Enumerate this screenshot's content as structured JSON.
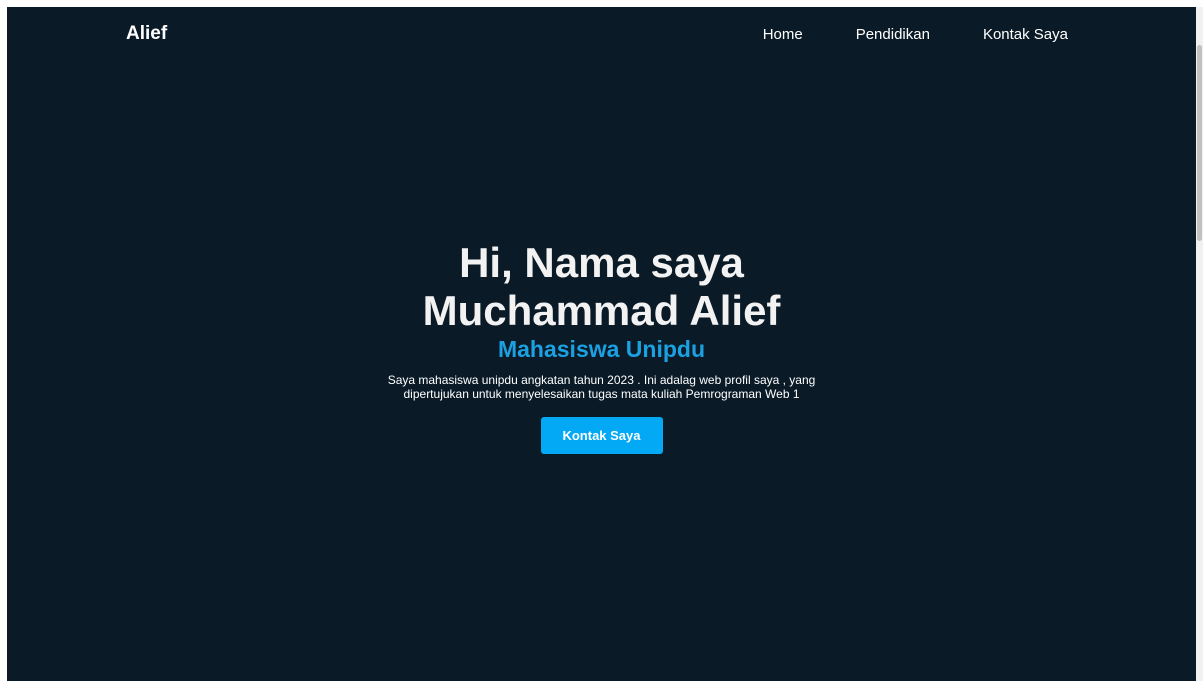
{
  "navbar": {
    "brand": "Alief",
    "links": [
      "Home",
      "Pendidikan",
      "Kontak Saya"
    ]
  },
  "hero": {
    "title_line1": "Hi, Nama saya",
    "title_line2": "Muchammad Alief",
    "subtitle": "Mahasiswa Unipdu",
    "description": "Saya mahasiswa unipdu angkatan tahun 2023 . Ini adalag web profil saya , yang dipertujukan untuk menyelesaikan tugas mata kuliah Pemrograman Web 1",
    "cta_label": "Kontak Saya"
  },
  "colors": {
    "background": "#0a1a27",
    "accent_text": "#1ba1e2",
    "button": "#03a9f4",
    "text": "#ffffff"
  }
}
